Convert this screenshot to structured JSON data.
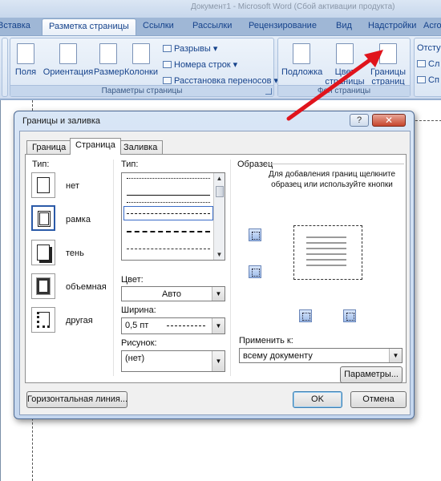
{
  "window": {
    "title": "Документ1 - Microsoft Word (Сбой активации продукта)"
  },
  "ribbon": {
    "tabs": [
      {
        "label": "Вставка"
      },
      {
        "label": "Разметка страницы",
        "active": true
      },
      {
        "label": "Ссылки"
      },
      {
        "label": "Рассылки"
      },
      {
        "label": "Рецензирование"
      },
      {
        "label": "Вид"
      },
      {
        "label": "Надстройки"
      },
      {
        "label": "Acrobat"
      }
    ],
    "page_setup": {
      "fields": "Поля",
      "orientation": "Ориентация",
      "size": "Размер",
      "columns": "Колонки",
      "breaks": "Разрывы",
      "line_numbers": "Номера строк",
      "hyphenation": "Расстановка переносов",
      "group_label": "Параметры страницы"
    },
    "page_background": {
      "watermark": "Подложка",
      "page_color": "Цвет страницы",
      "page_borders": "Границы страниц",
      "group_label": "Фон страницы"
    },
    "paragraph": {
      "indent": "Отступ",
      "left": "Сл",
      "right": "Сп"
    }
  },
  "dialog": {
    "title": "Границы и заливка",
    "help": "?",
    "close": "✕",
    "tabs": [
      {
        "label": "Граница"
      },
      {
        "label": "Страница",
        "active": true
      },
      {
        "label": "Заливка"
      }
    ],
    "setting": {
      "label": "Тип:",
      "items": [
        {
          "label": "нет"
        },
        {
          "label": "рамка",
          "selected": true
        },
        {
          "label": "тень"
        },
        {
          "label": "объемная"
        },
        {
          "label": "другая"
        }
      ]
    },
    "style": {
      "label": "Тип:"
    },
    "color": {
      "label": "Цвет:",
      "value": "Авто"
    },
    "width": {
      "label": "Ширина:",
      "value": "0,5 пт"
    },
    "art": {
      "label": "Рисунок:",
      "value": "(нет)"
    },
    "preview": {
      "label": "Образец",
      "description": "Для добавления границ щелкните образец или используйте кнопки"
    },
    "apply_to": {
      "label": "Применить к:",
      "value": "всему документу"
    },
    "options_button": "Параметры...",
    "horizontal_line_button": "Горизонтальная линия...",
    "ok_button": "OK",
    "cancel_button": "Отмена"
  },
  "colors": {
    "arrow": "#e0141c",
    "selection": "#2b5aa8"
  }
}
